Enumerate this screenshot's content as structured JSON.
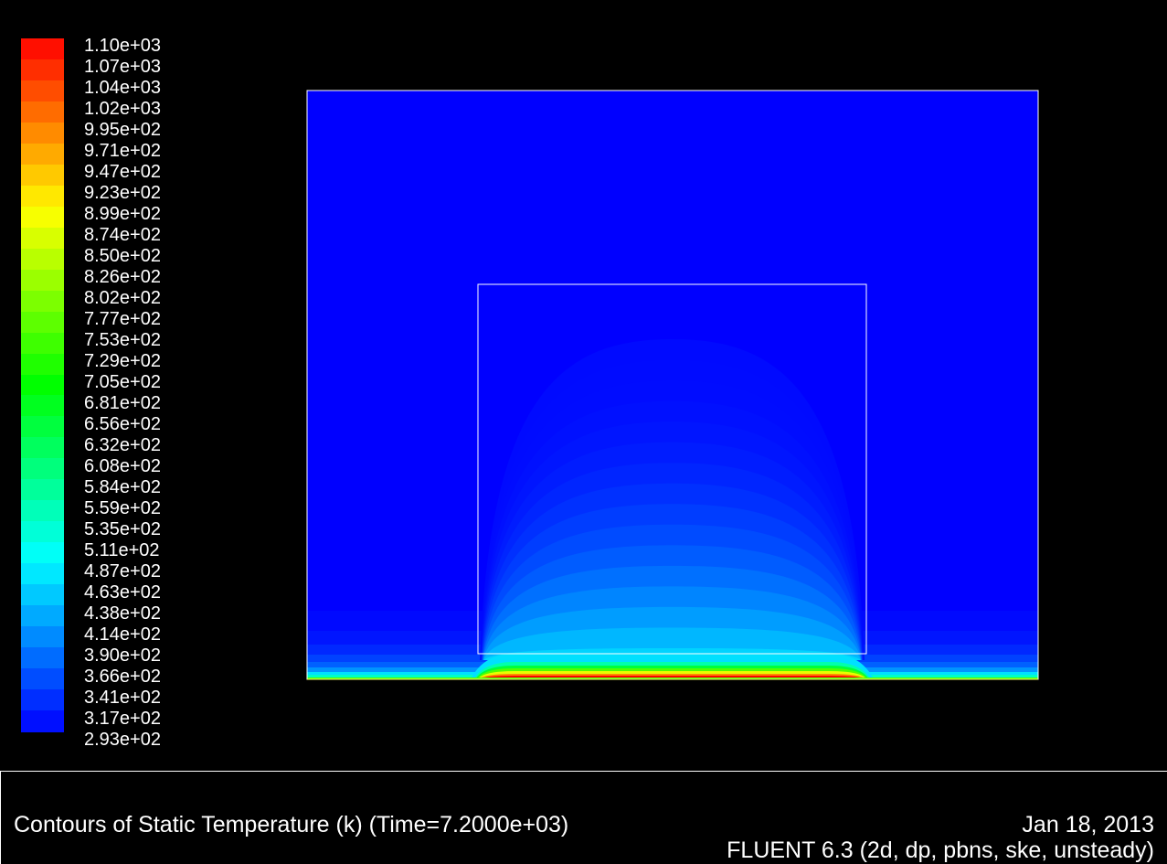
{
  "chart_data": {
    "type": "heatmap",
    "title": "Contours of Static Temperature (k)  (Time=7.2000e+03)",
    "quantity": "Static Temperature",
    "unit": "k",
    "time": "7.2000e+03",
    "colorbar": {
      "min": 293,
      "max": 1100,
      "colormap": "rainbow (blue-cyan-green-yellow-red)",
      "tick_labels": [
        "1.10e+03",
        "1.07e+03",
        "1.04e+03",
        "1.02e+03",
        "9.95e+02",
        "9.71e+02",
        "9.47e+02",
        "9.23e+02",
        "8.99e+02",
        "8.74e+02",
        "8.50e+02",
        "8.26e+02",
        "8.02e+02",
        "7.77e+02",
        "7.53e+02",
        "7.29e+02",
        "7.05e+02",
        "6.81e+02",
        "6.56e+02",
        "6.32e+02",
        "6.08e+02",
        "5.84e+02",
        "5.59e+02",
        "5.35e+02",
        "5.11e+02",
        "4.87e+02",
        "4.63e+02",
        "4.38e+02",
        "4.14e+02",
        "3.90e+02",
        "3.66e+02",
        "3.41e+02",
        "3.17e+02",
        "2.93e+02"
      ]
    },
    "field": {
      "ambient_temperature": 293,
      "bottom_wall_max_temperature": 1100,
      "plume_crest_temperature": 320
    }
  },
  "footer": {
    "caption": "Contours of Static Temperature (k)  (Time=7.2000e+03)",
    "date": "Jan 18, 2013",
    "solver": "FLUENT 6.3 (2d, dp, pbns, ske, unsteady)"
  },
  "colors": {
    "background": "#000000",
    "outline": "#ffffff",
    "footer_border": "#ffffff",
    "domain_edge": "#ffff66"
  }
}
